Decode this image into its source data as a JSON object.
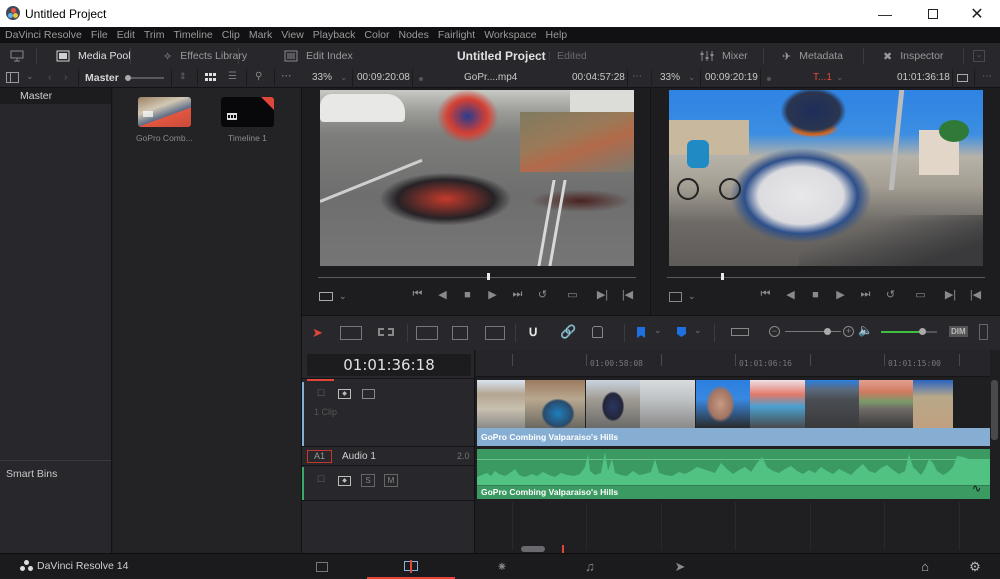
{
  "window": {
    "title": "Untitled Project",
    "minimize_icon": "minimize-icon",
    "maximize_icon": "maximize-icon",
    "close_icon": "close-icon"
  },
  "menu": [
    "DaVinci Resolve",
    "File",
    "Edit",
    "Trim",
    "Timeline",
    "Clip",
    "Mark",
    "View",
    "Playback",
    "Color",
    "Nodes",
    "Fairlight",
    "Workspace",
    "Help"
  ],
  "toolbar": {
    "media_pool": "Media Pool",
    "effects_library": "Effects Library",
    "edit_index": "Edit Index",
    "project_name": "Untitled Project",
    "project_status": "Edited",
    "mixer": "Mixer",
    "metadata": "Metadata",
    "inspector": "Inspector"
  },
  "bin_bar": {
    "bin_name": "Master"
  },
  "bin_list": {
    "master": "Master",
    "smart_bins": "Smart Bins"
  },
  "media_pool": {
    "items": [
      {
        "name": "GoPro Comb...",
        "type": "clip"
      },
      {
        "name": "Timeline 1",
        "type": "timeline"
      }
    ]
  },
  "source_viewer": {
    "zoom": "33%",
    "duration": "00:09:20:08",
    "clip_name": "GoPr....mp4",
    "timecode": "00:04:57:28",
    "playhead_fraction": 0.53
  },
  "timeline_viewer": {
    "zoom": "33%",
    "duration": "00:09:20:19",
    "timeline_name": "T...1",
    "timecode": "01:01:36:18",
    "playhead_fraction": 0.17
  },
  "timeline": {
    "timecode": "01:01:36:18",
    "ruler_labels": [
      "01:00:58:08",
      "01:01:06:16",
      "01:01:15:00"
    ],
    "video_track": {
      "clip_count": "1 Clip",
      "clip_name": "GoPro Combing Valparaiso's Hills"
    },
    "audio_track": {
      "id": "A1",
      "name": "Audio 1",
      "channels": "2.0",
      "solo": "S",
      "mute": "M",
      "clip_name": "GoPro Combing Valparaiso's Hills"
    },
    "zoom_level_fraction": 0.75,
    "volume_fraction": 0.73,
    "dim_label": "DIM"
  },
  "bottom": {
    "app_name": "DaVinci Resolve 14",
    "pages": [
      "media",
      "edit",
      "color",
      "fairlight",
      "deliver"
    ],
    "active_page": "edit"
  },
  "colors": {
    "accent_red": "#e0463a",
    "video_clip": "#86aed3",
    "audio_clip": "#3aa86b",
    "flag_blue": "#1e6fe0",
    "volume_green": "#3fbf3f"
  }
}
